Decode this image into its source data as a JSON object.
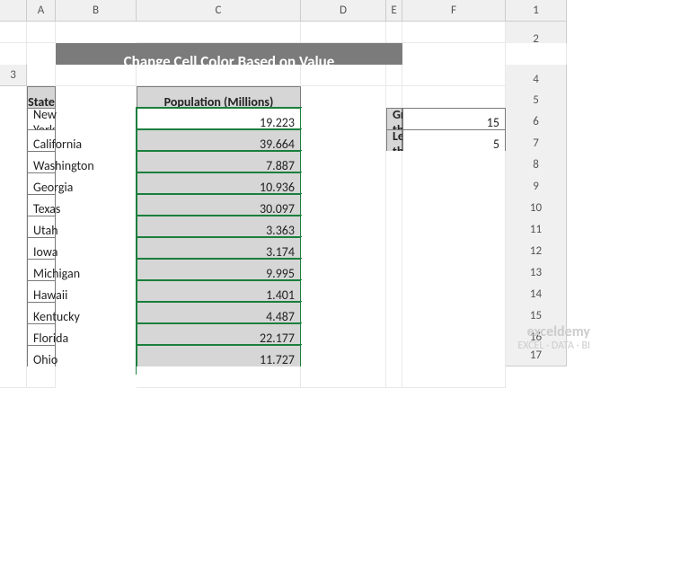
{
  "columns": [
    "A",
    "B",
    "C",
    "D",
    "E",
    "F"
  ],
  "title": "Change Cell Color Based on Value",
  "headers": {
    "state": "State",
    "population": "Population (Millions)"
  },
  "rows": [
    {
      "state": "New York",
      "pop": "19.223"
    },
    {
      "state": "California",
      "pop": "39.664"
    },
    {
      "state": "Washington",
      "pop": "7.887"
    },
    {
      "state": "Georgia",
      "pop": "10.936"
    },
    {
      "state": "Texas",
      "pop": "30.097"
    },
    {
      "state": "Utah",
      "pop": "3.363"
    },
    {
      "state": "Iowa",
      "pop": "3.174"
    },
    {
      "state": "Michigan",
      "pop": "9.995"
    },
    {
      "state": "Hawaii",
      "pop": "1.401"
    },
    {
      "state": "Kentucky",
      "pop": "4.487"
    },
    {
      "state": "Florida",
      "pop": "22.177"
    },
    {
      "state": "Ohio",
      "pop": "11.727"
    }
  ],
  "side": {
    "gt_label": "Greater than",
    "gt_val": "15",
    "lt_label": "Less than",
    "lt_val": "5"
  },
  "watermark": {
    "brand": "exceldemy",
    "tag": "EXCEL · DATA · BI"
  },
  "chart_data": {
    "type": "table",
    "title": "Change Cell Color Based on Value",
    "columns": [
      "State",
      "Population (Millions)"
    ],
    "data": [
      [
        "New York",
        19.223
      ],
      [
        "California",
        39.664
      ],
      [
        "Washington",
        7.887
      ],
      [
        "Georgia",
        10.936
      ],
      [
        "Texas",
        30.097
      ],
      [
        "Utah",
        3.363
      ],
      [
        "Iowa",
        3.174
      ],
      [
        "Michigan",
        9.995
      ],
      [
        "Hawaii",
        1.401
      ],
      [
        "Kentucky",
        4.487
      ],
      [
        "Florida",
        22.177
      ],
      [
        "Ohio",
        11.727
      ]
    ],
    "thresholds": {
      "greater_than": 15,
      "less_than": 5
    }
  }
}
